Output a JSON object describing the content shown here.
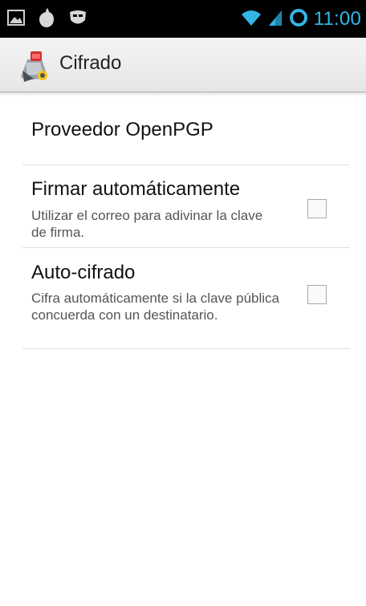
{
  "status_bar": {
    "left_icons": [
      "gallery-icon",
      "drop-icon",
      "mask-icon"
    ],
    "right_icons": [
      "wifi-icon",
      "signal-icon",
      "sync-ring-icon"
    ],
    "time": "11:00",
    "accent_color": "#33b5e5"
  },
  "action_bar": {
    "title": "Cifrado",
    "icon": "app-icon"
  },
  "preferences": [
    {
      "title": "Proveedor OpenPGP"
    },
    {
      "title": "Firmar automáticamente",
      "summary": "Utilizar el correo para adivinar la clave de firma.",
      "checked": false
    },
    {
      "title": "Auto-cifrado",
      "summary": "Cifra automáticamente si la clave pública concuerda con un destinatario.",
      "checked": false
    }
  ]
}
